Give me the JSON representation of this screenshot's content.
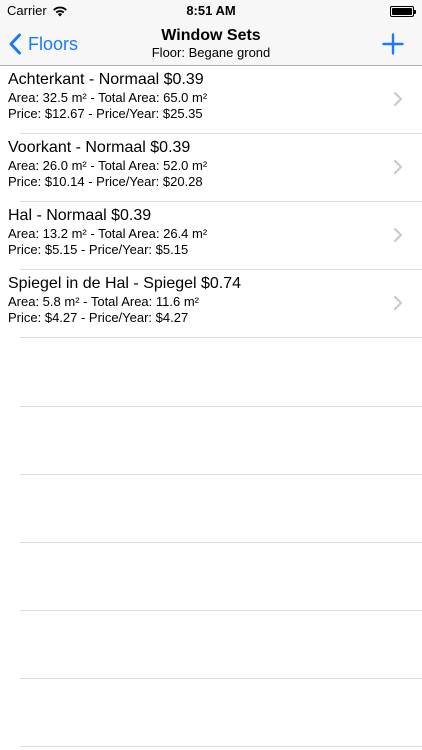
{
  "status_bar": {
    "carrier": "Carrier",
    "time": "8:51 AM"
  },
  "nav": {
    "back_label": "Floors",
    "title": "Window Sets",
    "subtitle": "Floor: Begane grond",
    "accent_color": "#1a7cf5"
  },
  "window_sets": [
    {
      "title": "Achterkant - Normaal $0.39",
      "area": "Area: 32.5 m² - Total Area: 65.0 m²",
      "price": "Price: $12.67 - Price/Year: $25.35"
    },
    {
      "title": "Voorkant - Normaal $0.39",
      "area": "Area: 26.0 m² - Total Area: 52.0 m²",
      "price": "Price: $10.14 - Price/Year: $20.28"
    },
    {
      "title": "Hal - Normaal $0.39",
      "area": "Area: 13.2 m² - Total Area: 26.4 m²",
      "price": "Price: $5.15 - Price/Year: $5.15"
    },
    {
      "title": "Spiegel in de Hal - Spiegel $0.74",
      "area": "Area: 5.8 m² - Total Area: 11.6 m²",
      "price": "Price: $4.27 - Price/Year: $4.27"
    }
  ]
}
